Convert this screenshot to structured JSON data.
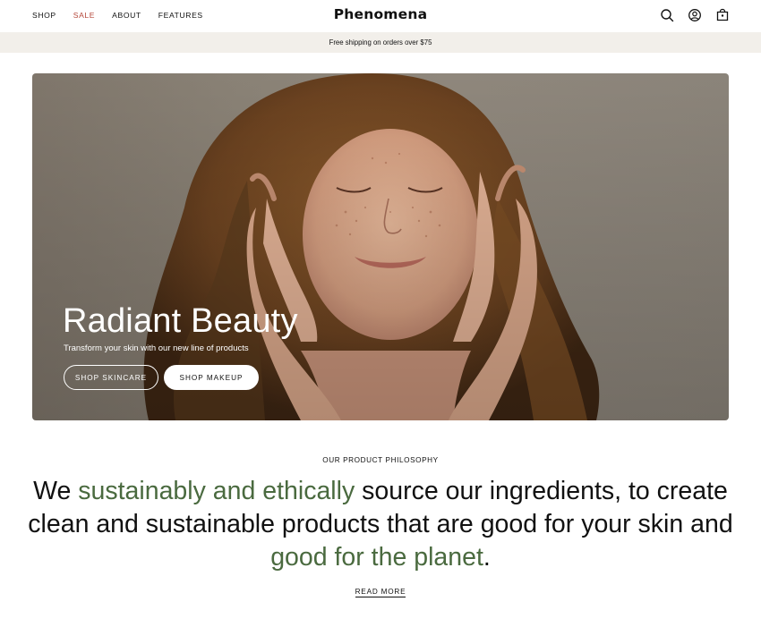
{
  "header": {
    "nav": [
      {
        "label": "SHOP"
      },
      {
        "label": "SALE"
      },
      {
        "label": "ABOUT"
      },
      {
        "label": "FEATURES"
      }
    ],
    "logo": "Phenomena",
    "icons": [
      "search-icon",
      "account-icon",
      "cart-icon"
    ]
  },
  "announcement": "Free shipping on orders over $75",
  "hero": {
    "title": "Radiant Beauty",
    "subtitle": "Transform your skin with our new line of products",
    "buttons": [
      {
        "label": "SHOP SKINCARE"
      },
      {
        "label": "SHOP MAKEUP"
      }
    ]
  },
  "philosophy": {
    "eyebrow": "OUR PRODUCT PHILOSOPHY",
    "parts": [
      {
        "text": "We "
      },
      {
        "text": "sustainably and ethically"
      },
      {
        "text": " source our ingredients, to create clean and sustainable products that are good for your skin and "
      },
      {
        "text": "good for the planet"
      },
      {
        "text": "."
      }
    ],
    "read_more": "READ MORE"
  },
  "colors": {
    "sale": "#b5483b",
    "accent_green": "#4a6a3f",
    "announcement_bg": "#f2efea"
  }
}
